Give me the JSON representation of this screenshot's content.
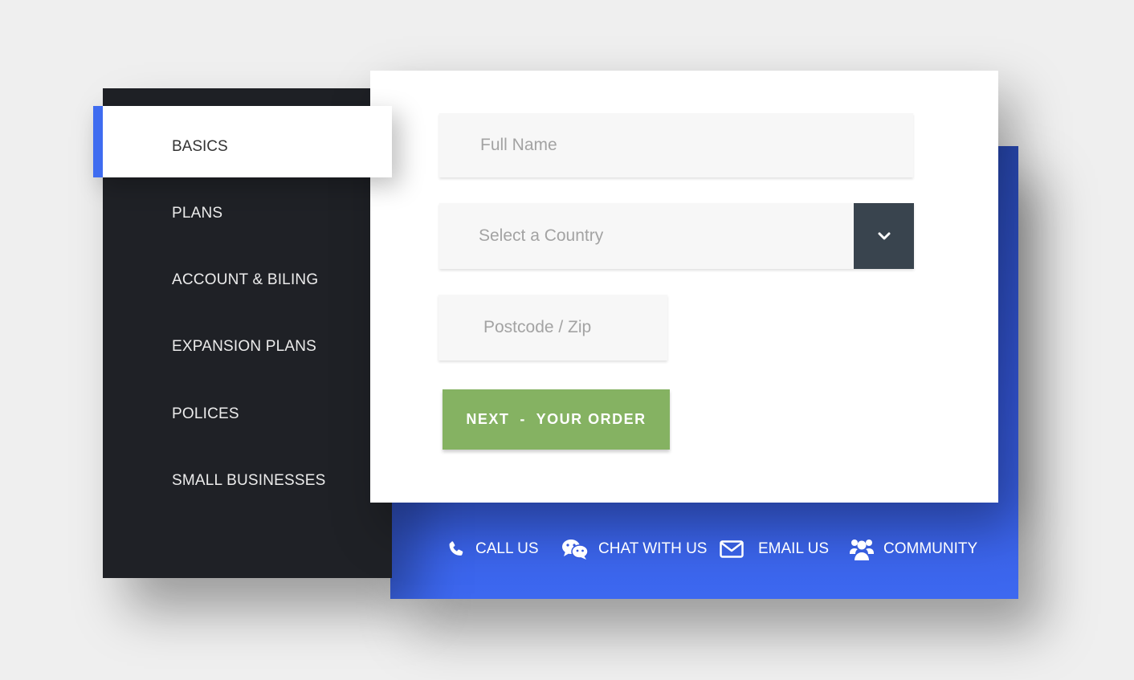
{
  "sidebar": {
    "active_item": "BASICS",
    "items": [
      {
        "label": "PLANS"
      },
      {
        "label": "ACCOUNT & BILING"
      },
      {
        "label": "EXPANSION PLANS"
      },
      {
        "label": "POLICES"
      },
      {
        "label": "SMALL BUSINESSES"
      }
    ]
  },
  "form": {
    "full_name_placeholder": "Full Name",
    "country_placeholder": "Select a Country",
    "postcode_placeholder": "Postcode / Zip",
    "next_label": "NEXT  -  YOUR ORDER"
  },
  "contact": {
    "items": [
      {
        "label": "CALL US",
        "icon": "phone-icon"
      },
      {
        "label": "CHAT WITH US",
        "icon": "wechat-icon"
      },
      {
        "label": "EMAIL US",
        "icon": "envelope-icon"
      },
      {
        "label": "COMMUNITY",
        "icon": "users-icon"
      }
    ]
  },
  "colors": {
    "accent_blue": "#3f6cf0",
    "sidebar_bg": "#1f2126",
    "button_green": "#85b262",
    "select_caret_bg": "#39444e"
  }
}
